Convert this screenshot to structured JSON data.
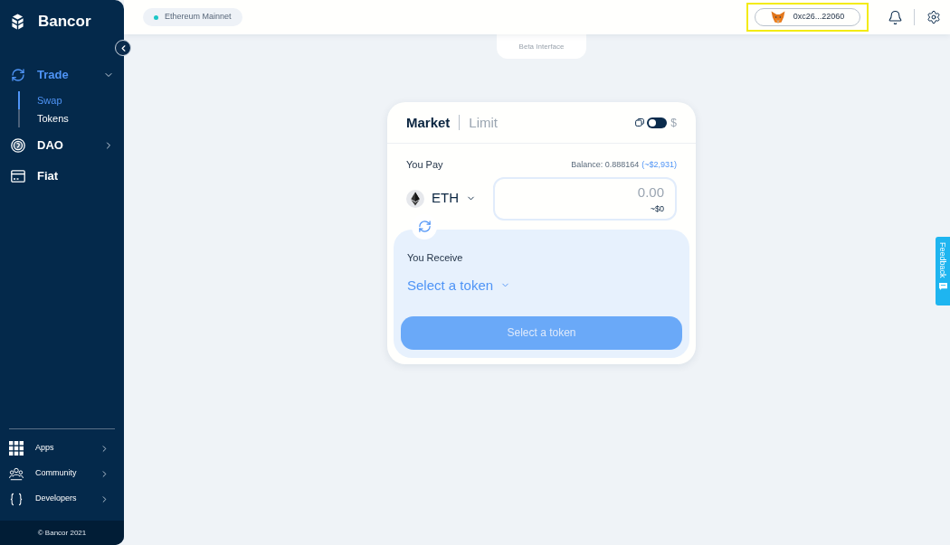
{
  "sidebar": {
    "brand": "Bancor",
    "items": [
      {
        "label": "Trade",
        "kind": "group",
        "selected": true,
        "expanded": true,
        "children": [
          {
            "label": "Swap",
            "selected": true
          },
          {
            "label": "Tokens",
            "selected": false
          }
        ]
      },
      {
        "label": "DAO",
        "kind": "group",
        "selected": false,
        "expanded": false
      },
      {
        "label": "Fiat",
        "kind": "link",
        "selected": false
      }
    ],
    "bottom_items": [
      {
        "label": "Apps"
      },
      {
        "label": "Community"
      },
      {
        "label": "Developers"
      }
    ],
    "footer": "© Bancor 2021"
  },
  "top_bar": {
    "network": {
      "label": "Ethereum Mainnet",
      "color": "#1cc6c6"
    },
    "wallet": {
      "address": "0xc26...22060",
      "highlighted": true
    }
  },
  "beta_label": "Beta Interface",
  "swap_card": {
    "tabs": [
      {
        "label": "Market",
        "selected": true
      },
      {
        "label": "Limit",
        "selected": false
      }
    ],
    "currency_toggle": {
      "on": false,
      "label": "$"
    },
    "pay": {
      "label": "You Pay",
      "balance": "Balance: 0.888164",
      "balance_usd": "(~$2,931)",
      "token": "ETH",
      "amount_placeholder": "0.00",
      "usd_value": "~$0"
    },
    "receive": {
      "label": "You Receive",
      "token_prompt": "Select a token"
    },
    "submit": {
      "label": "Select a token",
      "disabled": true
    }
  },
  "feedback": {
    "label": "Feedback"
  }
}
